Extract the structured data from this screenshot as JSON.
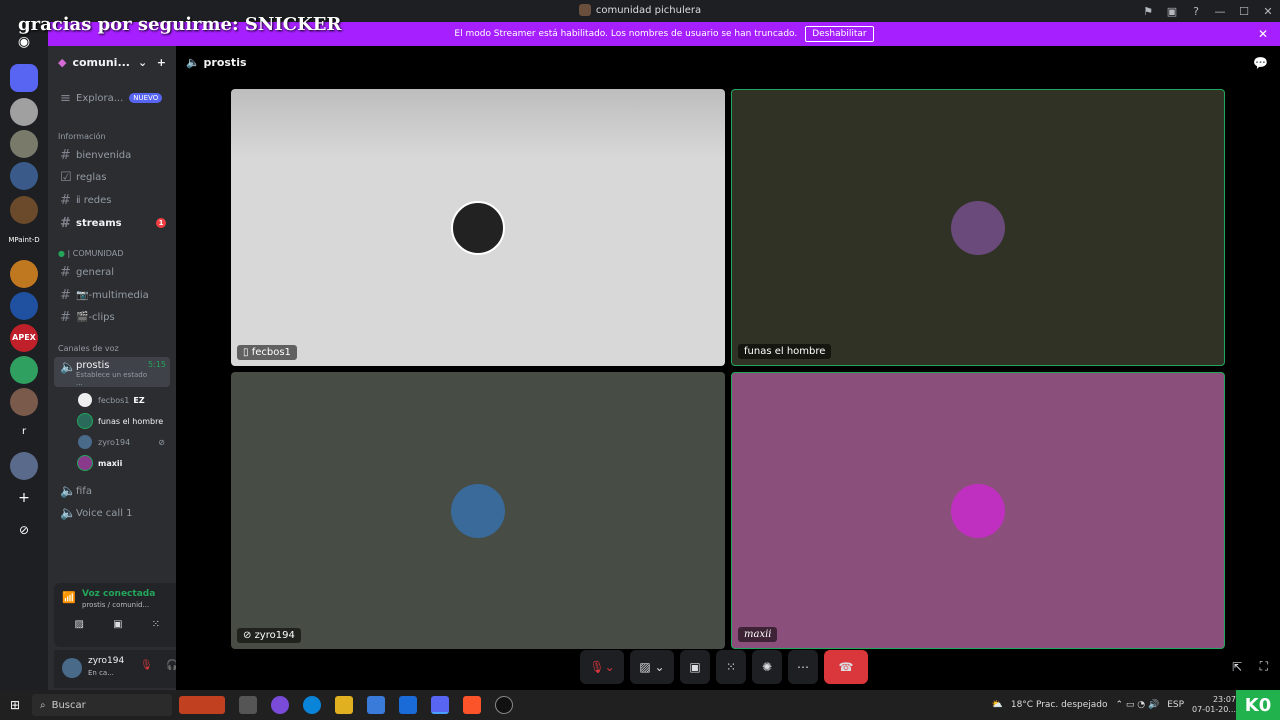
{
  "overlay": {
    "text": "gracias por seguirme: SNICKER"
  },
  "window": {
    "title": "comunidad pichulera"
  },
  "banner": {
    "text": "El modo Streamer está habilitado. Los nombres de usuario se han truncado.",
    "button": "Deshabilitar"
  },
  "server": {
    "name": "comuni...",
    "explore": "Explora...",
    "explore_badge": "NUEVO"
  },
  "categories": {
    "info": "Información",
    "community": "| COMUNIDAD",
    "voice": "Canales de voz"
  },
  "channels": {
    "bienvenida": "bienvenida",
    "reglas": "reglas",
    "redes": "ⅱ redes",
    "streams": "streams",
    "streams_badge": "1",
    "general": "general",
    "multimedia": "📷-multimedia",
    "clips": "🎬-clips"
  },
  "voice_channel": {
    "name": "prostis",
    "time": "5:15",
    "status": "Establece un estado ..."
  },
  "voice_users": [
    "fecbos1",
    "funas el hombre",
    "zyro194",
    "maxii"
  ],
  "voice_user_tag": "EZ",
  "other_voice": {
    "fifa": "fifa",
    "call": "Voice call 1"
  },
  "voice_panel": {
    "status": "Voz conectada",
    "detail": "prostis / comunid..."
  },
  "user_panel": {
    "name": "zyro194",
    "status": "En ca..."
  },
  "main": {
    "channel": "prostis"
  },
  "tiles": [
    {
      "name": "fecbos1",
      "color": "#d8d8d8"
    },
    {
      "name": "funas el hombre",
      "color": "#2f3225"
    },
    {
      "name": "zyro194",
      "color": "#474c44"
    },
    {
      "name": "maxii",
      "color": "#8a4f7b"
    }
  ],
  "taskbar": {
    "search": "Buscar",
    "weather": "18°C  Prac. despejado",
    "lang": "ESP",
    "time": "23:07",
    "date": "07-01-20..."
  },
  "brand_badge": "K0",
  "server_labels": {
    "mpaint": "MPaint-D",
    "apex": "APEX",
    "r": "r"
  }
}
